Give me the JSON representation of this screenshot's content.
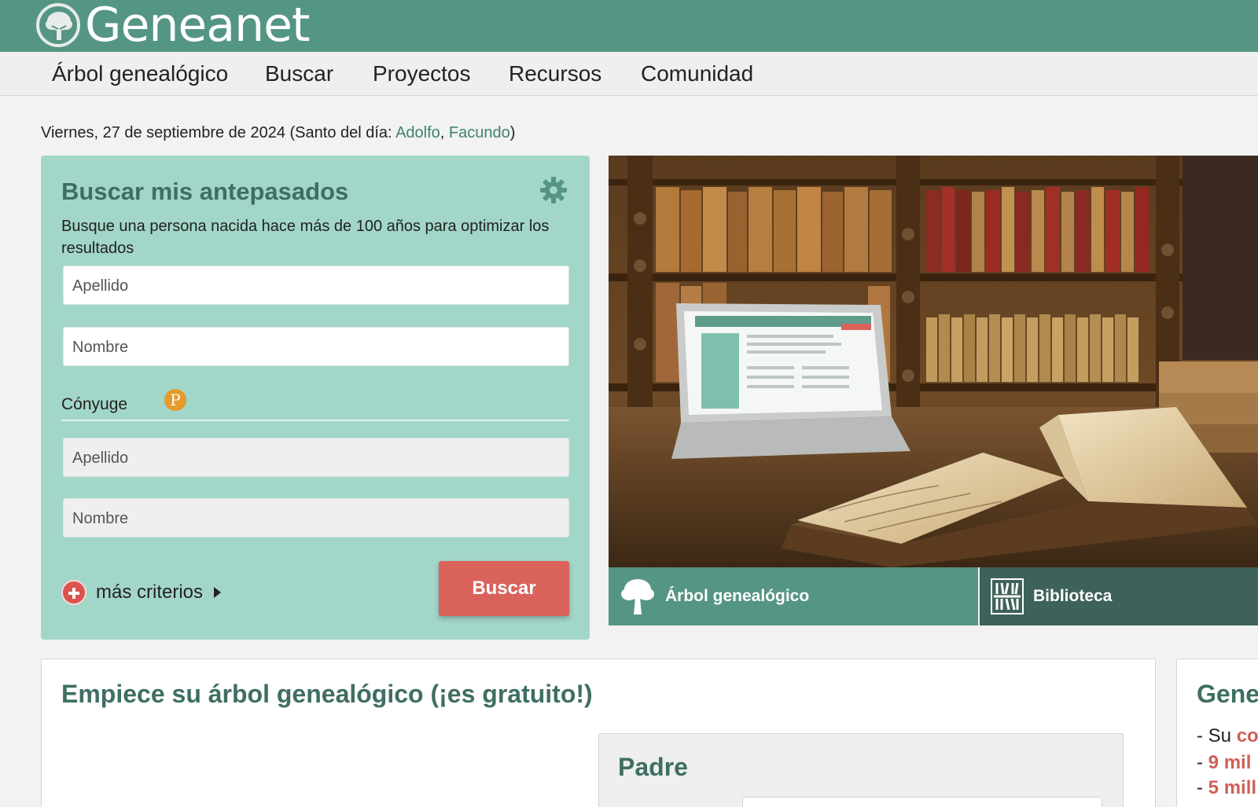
{
  "site": {
    "logo_text": "Geneanet"
  },
  "nav": {
    "items": [
      "Árbol genealógico",
      "Buscar",
      "Proyectos",
      "Recursos",
      "Comunidad"
    ]
  },
  "date_line": {
    "prefix": "Viernes, 27 de septiembre de 2024 (Santo del día: ",
    "saint1": "Adolfo",
    "sep": ", ",
    "saint2": "Facundo",
    "suffix": ")"
  },
  "search_form": {
    "title": "Buscar mis antepasados",
    "description": "Busque una persona nacida hace más de 100 años para optimizar los resultados",
    "surname_placeholder": "Apellido",
    "firstname_placeholder": "Nombre",
    "spouse_label": "Cónyuge",
    "premium_badge": "P",
    "spouse_surname_placeholder": "Apellido",
    "spouse_firstname_placeholder": "Nombre",
    "more_criteria": "más criterios",
    "search_button": "Buscar"
  },
  "hero": {
    "tabs": [
      "Árbol genealógico",
      "Biblioteca"
    ]
  },
  "tree_panel": {
    "title": "Empiece su árbol genealógico (¡es gratuito!)",
    "father_title": "Padre"
  },
  "side_panel": {
    "title": "Gene",
    "line1_prefix": "- Su ",
    "line1_highlight": "co",
    "line2_prefix": "- ",
    "line2_highlight": "9 mil",
    "line3_prefix": "- ",
    "line3_highlight": "5 mill"
  },
  "colors": {
    "header": "#559584",
    "panel": "#a2d6c8",
    "heading": "#3f6e63",
    "button": "#d9625b",
    "link": "#3e8270"
  },
  "icons": [
    "tree-logo-icon",
    "gear-icon",
    "plus-circle-icon",
    "triangle-right-icon",
    "tree-icon",
    "books-icon"
  ]
}
